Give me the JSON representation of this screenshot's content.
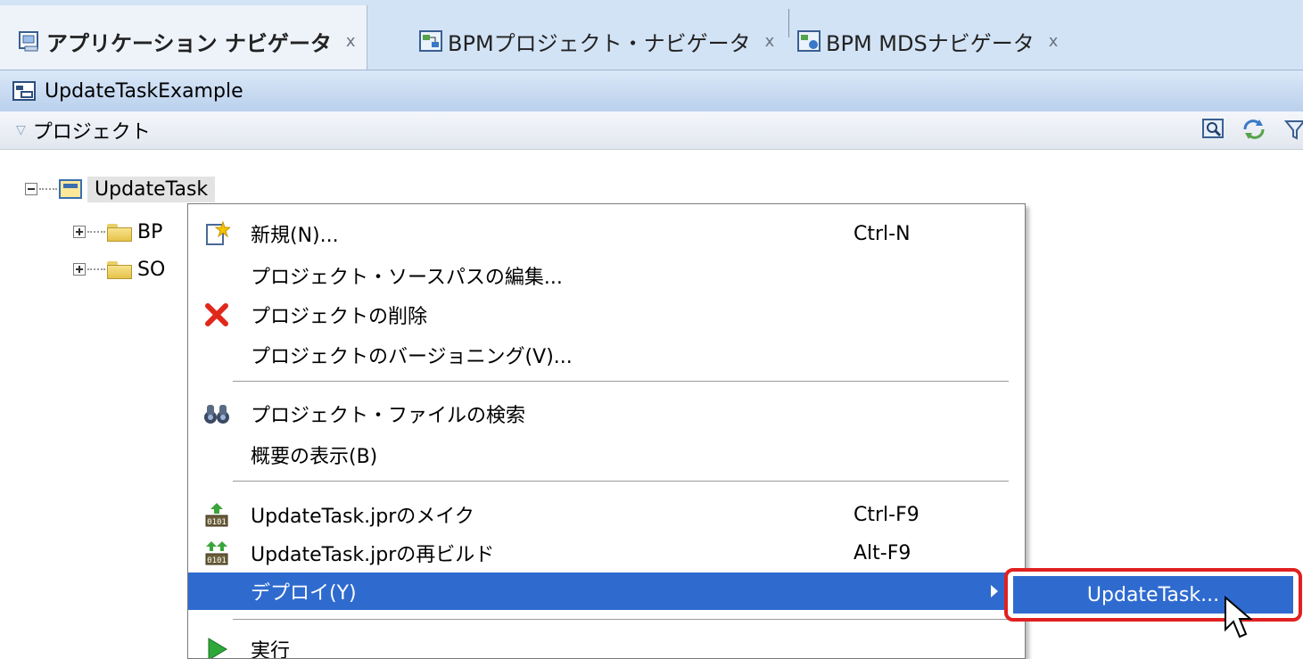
{
  "tabs": [
    {
      "label": "アプリケーション ナビゲータ",
      "close": "x",
      "icon": "app-navigator-icon",
      "active": true
    },
    {
      "label": "BPMプロジェクト・ナビゲータ",
      "close": "x",
      "icon": "bpm-project-navigator-icon",
      "active": false
    },
    {
      "label": "BPM MDSナビゲータ",
      "close": "x",
      "icon": "bpm-mds-navigator-icon",
      "active": false
    }
  ],
  "application": {
    "name": "UpdateTaskExample",
    "icon": "application-icon"
  },
  "projects_panel": {
    "title": "プロジェクト",
    "tool_icons": [
      "search-icon",
      "refresh-icon",
      "filter-icon"
    ]
  },
  "tree": {
    "root": {
      "label": "UpdateTask",
      "icon": "project-folder-icon",
      "expanded": true
    },
    "children": [
      {
        "label": "BP",
        "icon": "folder-icon"
      },
      {
        "label": "SO",
        "icon": "folder-icon"
      }
    ]
  },
  "context_menu": {
    "items": [
      {
        "label": "新規(N)...",
        "shortcut": "Ctrl-N",
        "icon": "new-icon"
      },
      {
        "label": "プロジェクト・ソースパスの編集...",
        "shortcut": "",
        "icon": ""
      },
      {
        "label": "プロジェクトの削除",
        "shortcut": "",
        "icon": "delete-icon"
      },
      {
        "label": "プロジェクトのバージョニング(V)...",
        "shortcut": "",
        "icon": ""
      },
      {
        "label": "プロジェクト・ファイルの検索",
        "shortcut": "",
        "icon": "binoculars-icon"
      },
      {
        "label": "概要の表示(B)",
        "shortcut": "",
        "icon": ""
      },
      {
        "label": "UpdateTask.jprのメイク",
        "shortcut": "Ctrl-F9",
        "icon": "make-icon"
      },
      {
        "label": "UpdateTask.jprの再ビルド",
        "shortcut": "Alt-F9",
        "icon": "rebuild-icon"
      },
      {
        "label": "デプロイ(Y)",
        "shortcut": "",
        "icon": "",
        "highlighted": true,
        "has_submenu": true
      },
      {
        "label": "実行",
        "shortcut": "",
        "icon": "run-icon"
      }
    ]
  },
  "submenu": {
    "items": [
      {
        "label": "UpdateTask..."
      }
    ],
    "highlight_color": "#e12020"
  },
  "colors": {
    "selection": "#2f6bcf",
    "tab_bar": "#d3e3f6",
    "highlight_frame": "#e12020"
  }
}
